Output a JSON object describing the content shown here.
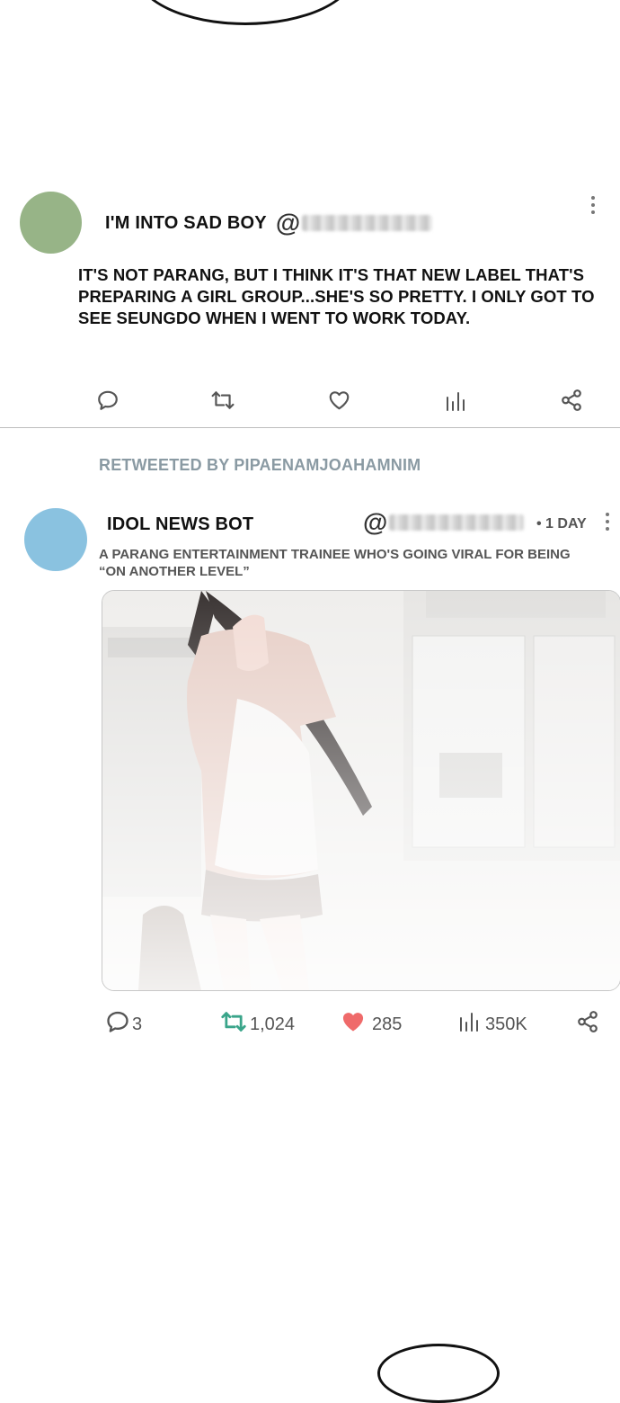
{
  "tweet1": {
    "display_name": "I'M INTO SAD BOY",
    "handle_prefix": "@",
    "body": "IT'S NOT PARANG, BUT I THINK IT'S THAT NEW LABEL THAT'S PREPARING A GIRL GROUP...SHE'S SO PRETTY. I ONLY GOT TO SEE SEUNGDO WHEN I WENT TO WORK TODAY.",
    "avatar_color": "#97b487"
  },
  "retweet": {
    "label": "RETWEETED BY PIPAENAMJOAHAMNIM"
  },
  "tweet2": {
    "display_name": "IDOL NEWS BOT",
    "handle_prefix": "@",
    "time": "• 1 DAY",
    "body": "A PARANG ENTERTAINMENT TRAINEE WHO'S GOING VIRAL FOR BEING “ON ANOTHER LEVEL”",
    "avatar_color": "#8ac2e0",
    "stats": {
      "replies": "3",
      "retweets": "1,024",
      "likes": "285",
      "views": "350K"
    }
  },
  "colors": {
    "retweet_green": "#3aa58a",
    "like_red": "#ef6a6a",
    "muted": "#8a9aa3"
  }
}
